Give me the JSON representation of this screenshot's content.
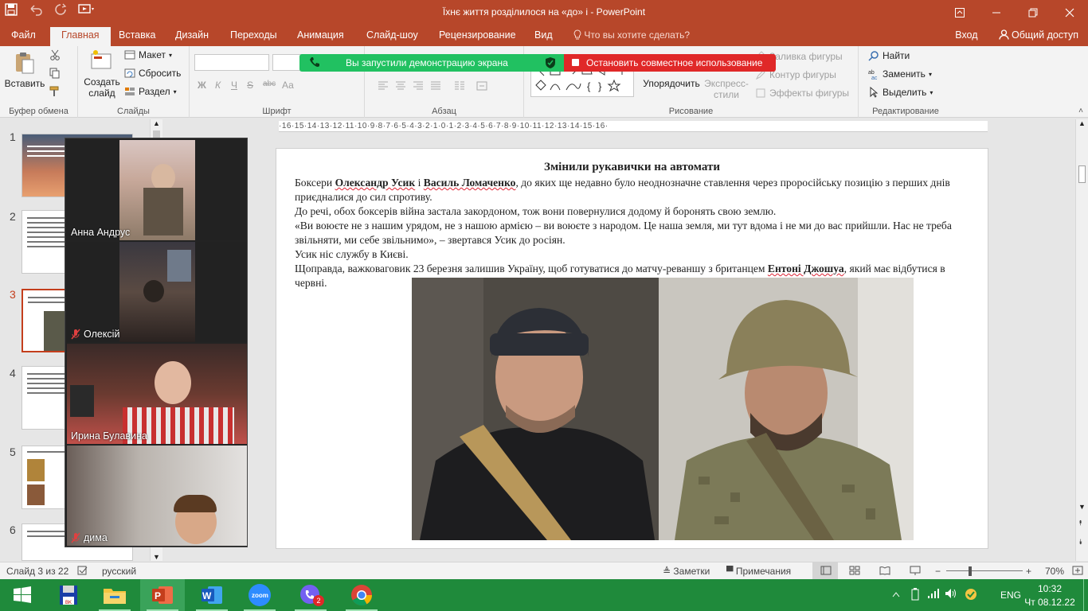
{
  "window": {
    "title": "Їхнє життя розділилося на «до» і - PowerPoint",
    "qat": [
      "save-icon",
      "undo-icon",
      "redo-icon",
      "slideshow-icon"
    ],
    "controls": [
      "ribbon-display-icon",
      "minimize-icon",
      "restore-icon",
      "close-icon"
    ]
  },
  "tabs": {
    "items": [
      "Файл",
      "Главная",
      "Вставка",
      "Дизайн",
      "Переходы",
      "Анимация",
      "Слайд-шоу",
      "Рецензирование",
      "Вид"
    ],
    "active": "Главная",
    "tellme": "Что вы хотите сделать?",
    "signin": "Вход",
    "share": "Общий доступ"
  },
  "ribbon": {
    "clipboard": {
      "paste": "Вставить",
      "label": "Буфер обмена"
    },
    "slides": {
      "new_slide_line1": "Создать",
      "new_slide_line2": "слайд",
      "layout": "Макет",
      "reset": "Сбросить",
      "section": "Раздел",
      "label": "Слайды"
    },
    "font": {
      "bold": "Ж",
      "italic": "К",
      "underline": "Ч",
      "strike": "S",
      "spacing": "abc",
      "case": "Аа",
      "label": "Шрифт"
    },
    "paragraph": {
      "label": "Абзац"
    },
    "drawing": {
      "arrange": "Упорядочить",
      "styles_line1": "Экспресс-",
      "styles_line2": "стили",
      "fill": "Заливка фигуры",
      "outline": "Контур фигуры",
      "effects": "Эффекты фигуры",
      "label": "Рисование"
    },
    "editing": {
      "find": "Найти",
      "replace": "Заменить",
      "select": "Выделить",
      "label": "Редактирование"
    }
  },
  "share_banner": {
    "status": "Вы запустили демонстрацию экрана",
    "stop": "Остановить совместное использование"
  },
  "thumbnails": {
    "numbers": [
      "1",
      "2",
      "3",
      "4",
      "5",
      "6"
    ],
    "selected": "3"
  },
  "zoom_participants": [
    {
      "name": "Анна Андрус",
      "muted": false
    },
    {
      "name": "Олексій",
      "muted": true
    },
    {
      "name": "Ирина Булавина",
      "muted": false
    },
    {
      "name": "дима",
      "muted": true
    }
  ],
  "ruler": {
    "ticks": "·16·15·14·13·12·11·10·9·8·7·6·5·4·3·2·1·0·1·2·3·4·5·6·7·8·9·10·11·12·13·14·15·16·"
  },
  "slide": {
    "title": "Змінили рукавички на автомати",
    "p1_a": "Боксери ",
    "p1_name1": "Олександр Усик",
    "p1_b": " і ",
    "p1_name2": "Василь Ломаченко",
    "p1_c": ", до яких ще недавно було неоднозначне ставлення через проросійську позицію з перших днів приєдналися до сил спротиву.",
    "p2": "До речі, обох боксерів війна застала закордоном, тож вони повернулися додому й боронять свою землю.",
    "p3": "«Ви воюєте не з нашим урядом, не з нашою армією – ви воюєте з народом. Це наша земля, ми тут вдома і не ми до вас прийшли. Нас не треба звільняти, ми себе звільнимо», – звертався Усик до росіян.",
    "p4": "Усик ніс службу в Києві.",
    "p5_a": "Щоправда, важковаговик 23 березня залишив Україну, щоб готуватися до матчу-реваншу з британцем ",
    "p5_name": "Ентоні Джошуа",
    "p5_b": ", який має відбутися в червні."
  },
  "status": {
    "slide_of": "Слайд 3 из 22",
    "language": "русский",
    "notes": "Заметки",
    "comments": "Примечания",
    "zoom": "70%"
  },
  "taskbar": {
    "apps": [
      "windows-start",
      "saver-app",
      "file-explorer",
      "powerpoint",
      "word",
      "zoom",
      "viber",
      "chrome"
    ],
    "viber_badge": "2",
    "lang": "ENG",
    "time": "10:32",
    "date": "Чт 08.12.22"
  },
  "colors": {
    "accent": "#b7472a",
    "share_green": "#21c161",
    "share_red": "#e02828",
    "taskbar": "#1f8a3b"
  }
}
